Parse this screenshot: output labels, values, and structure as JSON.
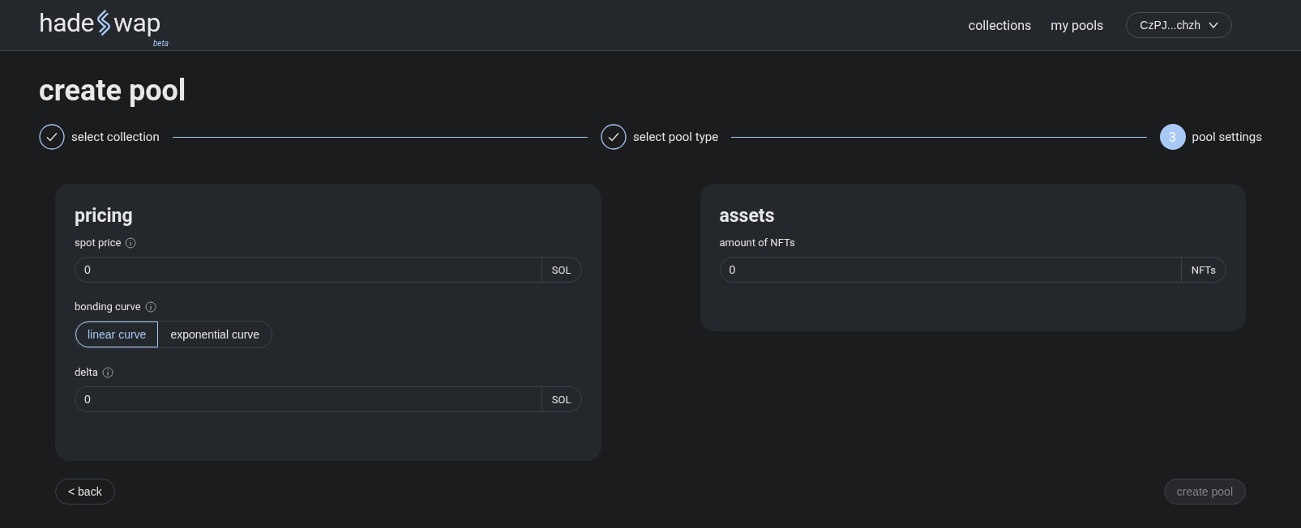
{
  "header": {
    "logo": {
      "left": "hade",
      "right": "wap",
      "tag": "beta"
    },
    "nav": [
      "collections",
      "my pools"
    ],
    "wallet": {
      "label": "CzPJ...chzh"
    }
  },
  "page_title": "create pool",
  "steps": [
    {
      "label": "select collection",
      "done": true
    },
    {
      "label": "select pool type",
      "done": true
    },
    {
      "number": "3",
      "label": "pool settings",
      "done": false
    }
  ],
  "cards": [
    {
      "title": "pricing",
      "sections": [
        {
          "kind": "input",
          "label": "spot price",
          "info": true,
          "value": "0",
          "unit": "SOL"
        },
        {
          "kind": "toggle",
          "label": "bonding curve",
          "info": true,
          "options": [
            {
              "label": "linear curve",
              "selected": true
            },
            {
              "label": "exponential curve",
              "selected": false
            }
          ]
        },
        {
          "kind": "input",
          "label": "delta",
          "info": true,
          "value": "0",
          "unit": "SOL"
        }
      ]
    },
    {
      "title": "assets",
      "sections": [
        {
          "kind": "input",
          "label": "amount of NFTs",
          "value": "0",
          "unit": "NFTs"
        }
      ]
    }
  ],
  "footer": {
    "back": "< back",
    "submit": {
      "label": "create pool",
      "disabled": true
    }
  }
}
